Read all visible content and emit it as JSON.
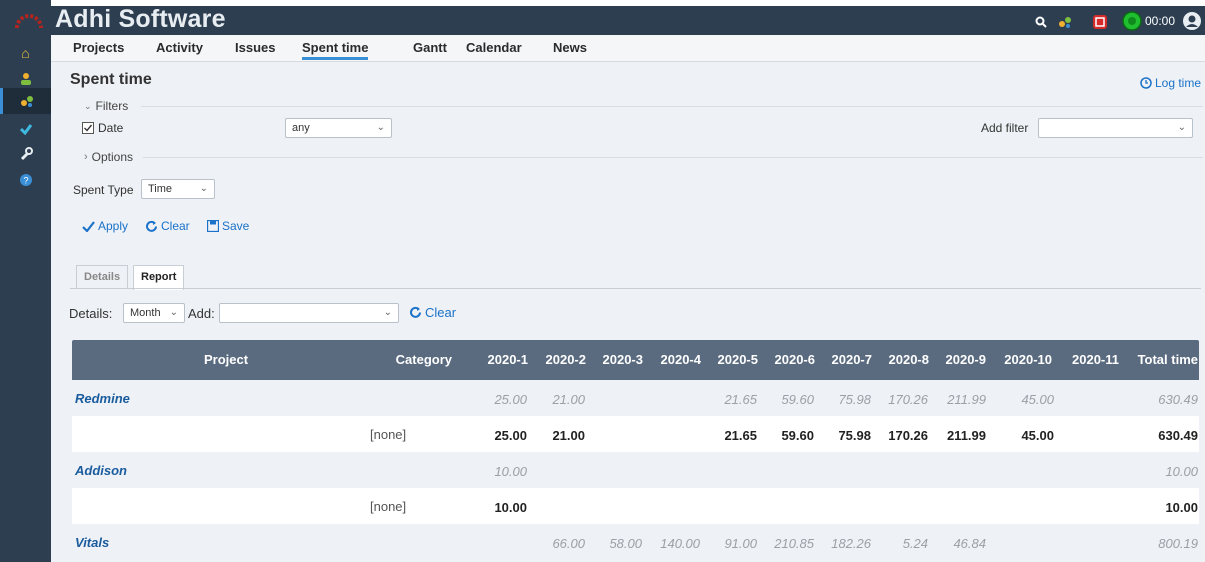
{
  "app": {
    "title": "Adhi Software",
    "timer": "00:00"
  },
  "colors": {
    "sidebar": "#2c3e50",
    "accent": "#3a8fd6",
    "link": "#1a72c9",
    "table_header": "#5a6b80"
  },
  "sidebar": {
    "items": [
      {
        "icon": "home-icon"
      },
      {
        "icon": "user-icon"
      },
      {
        "icon": "projects-icon"
      },
      {
        "icon": "check-icon"
      },
      {
        "icon": "wrench-icon"
      },
      {
        "icon": "help-icon"
      }
    ]
  },
  "topnav": {
    "tabs": [
      "Projects",
      "Activity",
      "Issues",
      "Spent time",
      "Gantt",
      "Calendar",
      "News"
    ],
    "selected": "Spent time"
  },
  "page": {
    "title": "Spent time",
    "log_time": "Log time"
  },
  "filters": {
    "legend": "Filters",
    "date_label": "Date",
    "date_value": "any",
    "add_filter_label": "Add filter",
    "add_filter_value": "",
    "options_legend": "Options"
  },
  "spent_type": {
    "label": "Spent Type",
    "value": "Time"
  },
  "actions": {
    "apply": "Apply",
    "clear": "Clear",
    "save": "Save"
  },
  "report_tabs": {
    "details": "Details",
    "report": "Report"
  },
  "report_controls": {
    "details_label": "Details:",
    "details_value": "Month",
    "add_label": "Add:",
    "add_value": "",
    "clear": "Clear"
  },
  "table": {
    "headers": [
      "Project",
      "Category",
      "2020-1",
      "2020-2",
      "2020-3",
      "2020-4",
      "2020-5",
      "2020-6",
      "2020-7",
      "2020-8",
      "2020-9",
      "2020-10",
      "2020-11",
      "Total time"
    ],
    "rows": [
      {
        "type": "project",
        "name": "Redmine",
        "values": [
          "25.00",
          "21.00",
          "",
          "",
          "21.65",
          "59.60",
          "75.98",
          "170.26",
          "211.99",
          "45.00",
          "",
          "630.49"
        ]
      },
      {
        "type": "category",
        "name": "[none]",
        "values": [
          "25.00",
          "21.00",
          "",
          "",
          "21.65",
          "59.60",
          "75.98",
          "170.26",
          "211.99",
          "45.00",
          "",
          "630.49"
        ]
      },
      {
        "type": "project",
        "name": "Addison",
        "values": [
          "10.00",
          "",
          "",
          "",
          "",
          "",
          "",
          "",
          "",
          "",
          "",
          "10.00"
        ]
      },
      {
        "type": "category",
        "name": "[none]",
        "values": [
          "10.00",
          "",
          "",
          "",
          "",
          "",
          "",
          "",
          "",
          "",
          "",
          "10.00"
        ]
      },
      {
        "type": "project",
        "name": "Vitals",
        "values": [
          "",
          "66.00",
          "58.00",
          "140.00",
          "91.00",
          "210.85",
          "182.26",
          "5.24",
          "46.84",
          "",
          "",
          "800.19"
        ]
      }
    ]
  }
}
